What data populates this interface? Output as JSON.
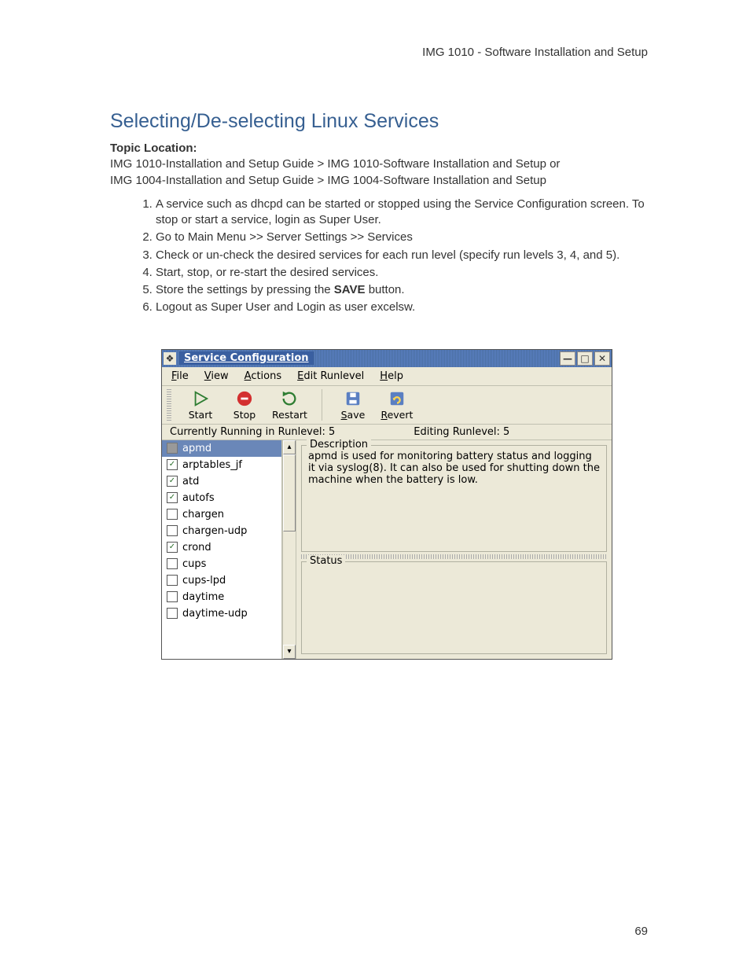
{
  "header": "IMG 1010 - Software Installation and Setup",
  "title": "Selecting/De-selecting Linux Services",
  "topic_label": "Topic Location:",
  "topic_line1": "IMG 1010-Installation and Setup Guide  > IMG 1010-Software Installation and Setup or",
  "topic_line2": "IMG 1004-Installation and Setup Guide  > IMG 1004-Software Installation and Setup",
  "steps": {
    "s1": "A service such as dhcpd can be started or stopped using the Service Configuration screen. To stop or start a service, login as Super User.",
    "s2": "Go to Main Menu >> Server Settings >> Services",
    "s3": "Check or un-check the desired services for each run level (specify run levels 3, 4, and 5).",
    "s4": "Start, stop, or re-start the desired services.",
    "s5a": "Store the settings by pressing the ",
    "s5b": "SAVE",
    "s5c": " button.",
    "s6": "Logout as Super User and Login as user excelsw."
  },
  "window": {
    "title": "Service Configuration",
    "menus": {
      "file": "File",
      "view": "View",
      "actions": "Actions",
      "edit": "Edit Runlevel",
      "help": "Help"
    },
    "tools": {
      "start": "Start",
      "stop": "Stop",
      "restart": "Restart",
      "save": "Save",
      "revert": "Revert"
    },
    "status_left": "Currently Running in Runlevel: 5",
    "status_right": "Editing Runlevel: 5",
    "services": [
      {
        "name": "apmd",
        "checked": "gray",
        "selected": true
      },
      {
        "name": "arptables_jf",
        "checked": true
      },
      {
        "name": "atd",
        "checked": true
      },
      {
        "name": "autofs",
        "checked": true
      },
      {
        "name": "chargen",
        "checked": false
      },
      {
        "name": "chargen-udp",
        "checked": false
      },
      {
        "name": "crond",
        "checked": true
      },
      {
        "name": "cups",
        "checked": false
      },
      {
        "name": "cups-lpd",
        "checked": false
      },
      {
        "name": "daytime",
        "checked": false
      },
      {
        "name": "daytime-udp",
        "checked": false
      }
    ],
    "desc_legend": "Description",
    "desc_text": "apmd is used for monitoring battery status and logging it via syslog(8). It can also be used for shutting down the machine when the battery is low.",
    "status_legend": "Status"
  },
  "page_number": "69"
}
